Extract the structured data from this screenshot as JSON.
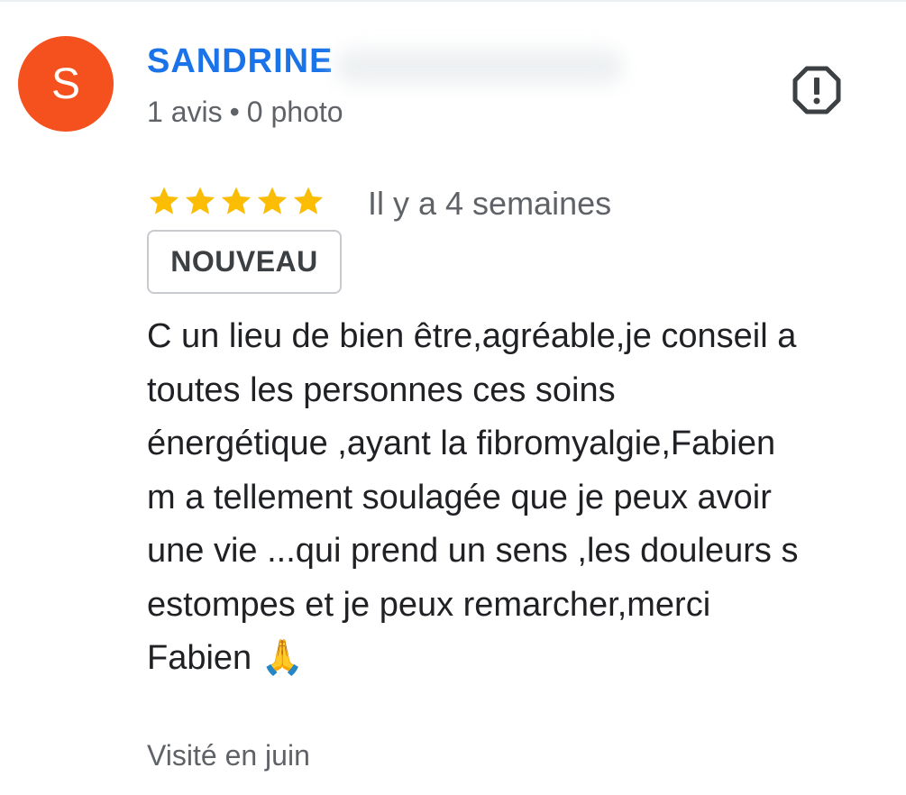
{
  "colors": {
    "avatar_bg": "#f4511e",
    "author_name": "#1a73e8",
    "star": "#fbbc04"
  },
  "review": {
    "author": {
      "avatar_letter": "S",
      "name": "SANDRINE",
      "review_count": "1 avis",
      "separator": "•",
      "photo_count": "0 photo"
    },
    "report_icon": "report-icon",
    "rating": 5,
    "rating_max": 5,
    "time_ago": "Il y a 4 semaines",
    "badge": "NOUVEAU",
    "text": "C un lieu de bien être,agréable,je conseil a\ntoutes les personnes ces soins\nénergétique ,ayant la fibromyalgie,Fabien\nm a tellement soulagée que je peux avoir\nune vie ...qui prend un sens ,les douleurs s\nestompes et je peux remarcher,merci\nFabien 🙏",
    "visited": "Visité en juin"
  }
}
